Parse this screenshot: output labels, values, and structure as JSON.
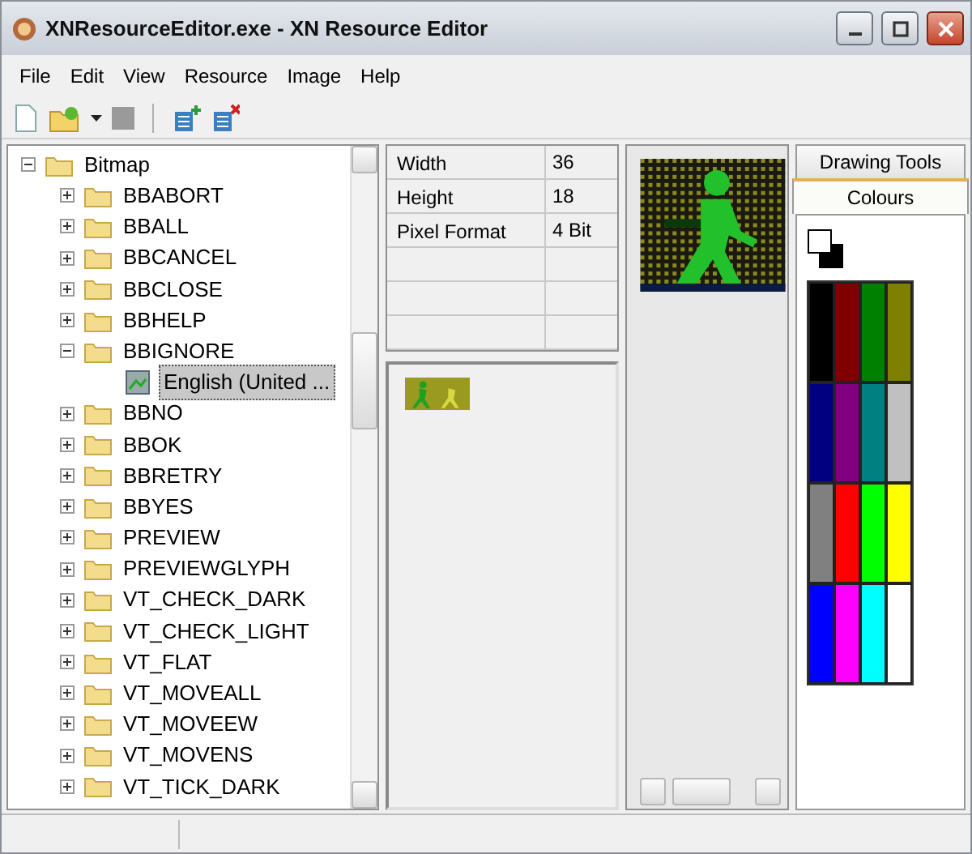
{
  "window": {
    "title": "XNResourceEditor.exe - XN Resource Editor"
  },
  "menu": [
    "File",
    "Edit",
    "View",
    "Resource",
    "Image",
    "Help"
  ],
  "tree": [
    {
      "label": "Bitmap",
      "expanded": true,
      "selected": false,
      "children": [
        {
          "label": "BBABORT",
          "expanded": false,
          "selected": false
        },
        {
          "label": "BBALL",
          "expanded": false,
          "selected": false
        },
        {
          "label": "BBCANCEL",
          "expanded": false,
          "selected": false
        },
        {
          "label": "BBCLOSE",
          "expanded": false,
          "selected": false
        },
        {
          "label": "BBHELP",
          "expanded": false,
          "selected": false
        },
        {
          "label": "BBIGNORE",
          "expanded": true,
          "selected": false,
          "children": [
            {
              "label": "English (United ...",
              "kind": "resource",
              "selected": true
            }
          ]
        },
        {
          "label": "BBNO",
          "expanded": false,
          "selected": false
        },
        {
          "label": "BBOK",
          "expanded": false,
          "selected": false
        },
        {
          "label": "BBRETRY",
          "expanded": false,
          "selected": false
        },
        {
          "label": "BBYES",
          "expanded": false,
          "selected": false
        },
        {
          "label": "PREVIEW",
          "expanded": false,
          "selected": false
        },
        {
          "label": "PREVIEWGLYPH",
          "expanded": false,
          "selected": false
        },
        {
          "label": "VT_CHECK_DARK",
          "expanded": false,
          "selected": false
        },
        {
          "label": "VT_CHECK_LIGHT",
          "expanded": false,
          "selected": false
        },
        {
          "label": "VT_FLAT",
          "expanded": false,
          "selected": false
        },
        {
          "label": "VT_MOVEALL",
          "expanded": false,
          "selected": false
        },
        {
          "label": "VT_MOVEEW",
          "expanded": false,
          "selected": false
        },
        {
          "label": "VT_MOVENS",
          "expanded": false,
          "selected": false
        },
        {
          "label": "VT_TICK_DARK",
          "expanded": false,
          "selected": false
        }
      ]
    }
  ],
  "properties": [
    {
      "name": "Width",
      "value": "36"
    },
    {
      "name": "Height",
      "value": "18"
    },
    {
      "name": "Pixel Format",
      "value": "4 Bit"
    }
  ],
  "tabs": [
    {
      "label": "Drawing Tools",
      "selected": false
    },
    {
      "label": "Colours",
      "selected": true
    }
  ],
  "current_colours": [
    {
      "kind": "foreground",
      "color": "#ffffff"
    },
    {
      "kind": "background",
      "color": "#000000"
    }
  ],
  "palette": [
    {
      "color": "#000000"
    },
    {
      "color": "#800000"
    },
    {
      "color": "#008000"
    },
    {
      "color": "#808000"
    },
    {
      "color": "#000080"
    },
    {
      "color": "#800080"
    },
    {
      "color": "#008080"
    },
    {
      "color": "#c0c0c0"
    },
    {
      "color": "#808080"
    },
    {
      "color": "#ff0000"
    },
    {
      "color": "#00ff00"
    },
    {
      "color": "#ffff00"
    },
    {
      "color": "#0000ff"
    },
    {
      "color": "#ff00ff"
    },
    {
      "color": "#00ffff"
    },
    {
      "color": "#ffffff"
    }
  ]
}
